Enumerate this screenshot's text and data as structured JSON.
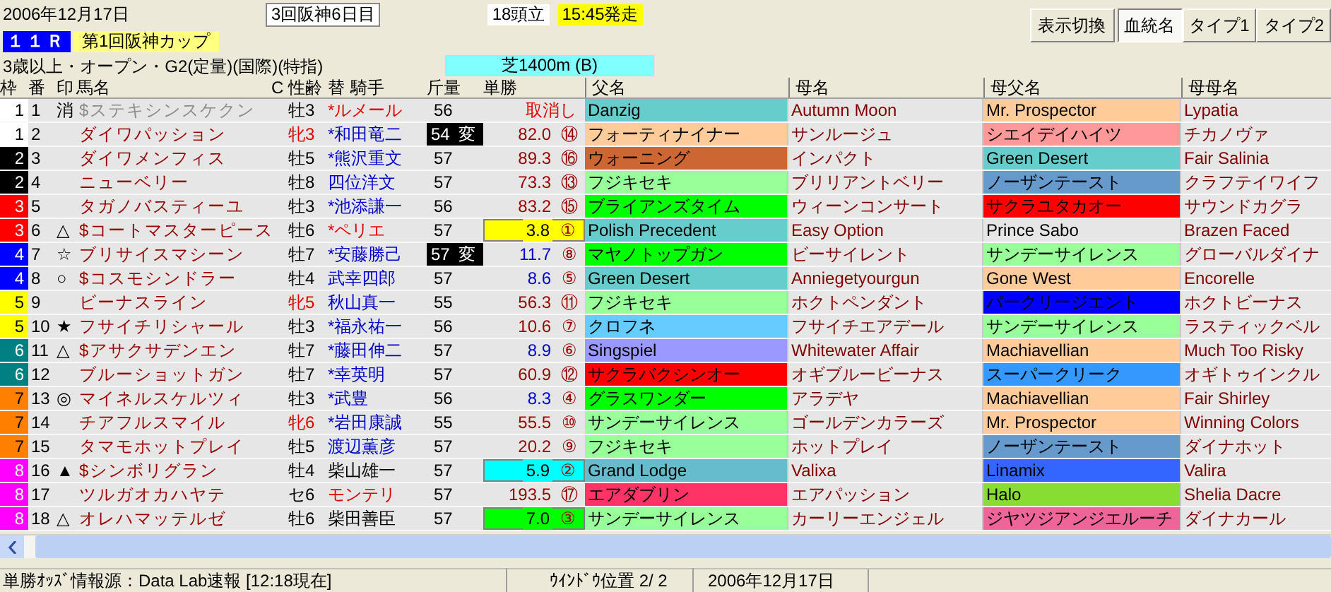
{
  "header": {
    "date": "2006年12月17日",
    "meeting": "3回阪神6日目",
    "runners": "18頭立",
    "post_time": "15:45発走",
    "race_number": "１１Ｒ",
    "race_name": "第1回阪神カップ",
    "conditions": "3歳以上・オープン・G2(定量)(国際)(特指)",
    "course": "芝1400m (B)"
  },
  "display_toggle": "表示切換",
  "view_buttons": [
    {
      "label": "血統名",
      "selected": true
    },
    {
      "label": "タイプ1",
      "selected": false
    },
    {
      "label": "タイプ2",
      "selected": false
    }
  ],
  "columns": [
    "枠",
    "番",
    "印",
    "馬名",
    "C",
    "性齢",
    "替",
    "騎手",
    "斤量",
    "単勝",
    "父名",
    "母名",
    "母父名",
    "母母名"
  ],
  "rows": [
    {
      "frame": {
        "text": "1",
        "color": "#ffffff"
      },
      "number": "1",
      "mark": "消",
      "name": "$ステキシンスケクン",
      "scratched": true,
      "sex_age": {
        "text": "牡3",
        "color": "#000000"
      },
      "jockey": {
        "text": "*ルメール",
        "color": "#e00000"
      },
      "weight": "56",
      "odds": {
        "text": "取消し",
        "color": "#e00000"
      },
      "sire": {
        "text": "Danzig",
        "color": "#66cccc"
      },
      "dam": {
        "text": "Autumn Moon"
      },
      "damsire": {
        "text": "Mr. Prospector",
        "color": "#ffcc99"
      },
      "second_dam": {
        "text": "Lypatia"
      }
    },
    {
      "frame": {
        "text": "1",
        "color": "#ffffff"
      },
      "number": "2",
      "name": "ダイワパッション",
      "scratched": false,
      "sex_age": {
        "text": "牝3",
        "color": "#e00000"
      },
      "jockey": {
        "text": "*和田竜二",
        "color": "#0000cc"
      },
      "weight": "54",
      "weight_note": "変",
      "odds": {
        "text": "82.0",
        "color": "#990000"
      },
      "rank": "⑭",
      "sire": {
        "text": "フォーティナイナー",
        "color": "#ffcc99"
      },
      "dam": {
        "text": "サンルージュ"
      },
      "damsire": {
        "text": "シエイデイハイツ",
        "color": "#ff9999"
      },
      "second_dam": {
        "text": "チカノヴァ"
      }
    },
    {
      "frame": {
        "text": "2",
        "color": "#000000"
      },
      "number": "3",
      "name": "ダイワメンフィス",
      "scratched": false,
      "sex_age": {
        "text": "牡5",
        "color": "#000000"
      },
      "jockey": {
        "text": "*熊沢重文",
        "color": "#0000cc"
      },
      "weight": "57",
      "odds": {
        "text": "89.3",
        "color": "#990000"
      },
      "rank": "⑯",
      "sire": {
        "text": "ウォーニング",
        "color": "#cc6633"
      },
      "dam": {
        "text": "インパクト"
      },
      "damsire": {
        "text": "Green Desert",
        "color": "#66cccc"
      },
      "second_dam": {
        "text": "Fair Salinia"
      }
    },
    {
      "frame": {
        "text": "2",
        "color": "#000000"
      },
      "number": "4",
      "name": "ニューベリー",
      "scratched": false,
      "sex_age": {
        "text": "牡8",
        "color": "#000000"
      },
      "jockey": {
        "text": "四位洋文",
        "color": "#0000cc"
      },
      "weight": "57",
      "odds": {
        "text": "73.3",
        "color": "#990000"
      },
      "rank": "⑬",
      "sire": {
        "text": "フジキセキ",
        "color": "#99ff99"
      },
      "dam": {
        "text": "ブリリアントベリー"
      },
      "damsire": {
        "text": "ノーザンテースト",
        "color": "#6699cc"
      },
      "second_dam": {
        "text": "クラフテイワイフ"
      }
    },
    {
      "frame": {
        "text": "3",
        "color": "#ff0000"
      },
      "number": "5",
      "name": "タガノバスティーユ",
      "scratched": false,
      "sex_age": {
        "text": "牡3",
        "color": "#000000"
      },
      "jockey": {
        "text": "*池添謙一",
        "color": "#0000cc"
      },
      "weight": "56",
      "odds": {
        "text": "83.2",
        "color": "#990000"
      },
      "rank": "⑮",
      "sire": {
        "text": "ブライアンズタイム",
        "color": "#00ff00"
      },
      "dam": {
        "text": "ウィーンコンサート"
      },
      "damsire": {
        "text": "サクラユタカオー",
        "color": "#ff0000"
      },
      "second_dam": {
        "text": "サウンドカグラ"
      }
    },
    {
      "frame": {
        "text": "3",
        "color": "#ff0000"
      },
      "number": "6",
      "mark": "△",
      "name": "$コートマスターピース",
      "scratched": false,
      "sex_age": {
        "text": "牡6",
        "color": "#000000"
      },
      "jockey": {
        "text": "*ペリエ",
        "color": "#e00000"
      },
      "weight": "57",
      "odds": {
        "text": "3.8"
      },
      "odds_box": {
        "color": "#ffff00"
      },
      "rank": "①",
      "sire": {
        "text": "Polish Precedent",
        "color": "#66cccc"
      },
      "dam": {
        "text": "Easy Option"
      },
      "damsire": {
        "text": "Prince Sabo"
      },
      "second_dam": {
        "text": "Brazen Faced"
      }
    },
    {
      "frame": {
        "text": "4",
        "color": "#0000ff"
      },
      "number": "7",
      "mark": "☆",
      "name": "ブリサイスマシーン",
      "scratched": false,
      "sex_age": {
        "text": "牡7",
        "color": "#000000"
      },
      "jockey": {
        "text": "*安藤勝己",
        "color": "#0000cc"
      },
      "weight": "57",
      "weight_note": "変",
      "odds": {
        "text": "11.7",
        "color": "#0000cc"
      },
      "rank": "⑧",
      "sire": {
        "text": "マヤノトップガン",
        "color": "#00ff00"
      },
      "dam": {
        "text": "ビーサイレント"
      },
      "damsire": {
        "text": "サンデーサイレンス",
        "color": "#99ff99"
      },
      "second_dam": {
        "text": "グローバルダイナ"
      }
    },
    {
      "frame": {
        "text": "4",
        "color": "#0000ff"
      },
      "number": "8",
      "mark": "○",
      "name": "$コスモシンドラー",
      "scratched": false,
      "sex_age": {
        "text": "牡4",
        "color": "#000000"
      },
      "jockey": {
        "text": "武幸四郎",
        "color": "#0000cc"
      },
      "weight": "57",
      "odds": {
        "text": "8.6",
        "color": "#0000cc"
      },
      "rank": "⑤",
      "sire": {
        "text": "Green Desert",
        "color": "#66cccc"
      },
      "dam": {
        "text": "Anniegetyourgun"
      },
      "damsire": {
        "text": "Gone West",
        "color": "#ffcc99"
      },
      "second_dam": {
        "text": "Encorelle"
      }
    },
    {
      "frame": {
        "text": "5",
        "color": "#ffff00"
      },
      "number": "9",
      "name": "ビーナスライン",
      "scratched": false,
      "sex_age": {
        "text": "牝5",
        "color": "#e00000"
      },
      "jockey": {
        "text": "秋山真一",
        "color": "#0000cc"
      },
      "weight": "55",
      "odds": {
        "text": "56.3",
        "color": "#990000"
      },
      "rank": "⑪",
      "sire": {
        "text": "フジキセキ",
        "color": "#99ff99"
      },
      "dam": {
        "text": "ホクトペンダント"
      },
      "damsire": {
        "text": "パークリージエント",
        "color": "#0000ff"
      },
      "second_dam": {
        "text": "ホクトビーナス"
      }
    },
    {
      "frame": {
        "text": "5",
        "color": "#ffff00"
      },
      "number": "10",
      "mark": "★",
      "name": "フサイチリシャール",
      "scratched": false,
      "sex_age": {
        "text": "牡3",
        "color": "#000000"
      },
      "jockey": {
        "text": "*福永祐一",
        "color": "#0000cc"
      },
      "weight": "56",
      "odds": {
        "text": "10.6",
        "color": "#990000"
      },
      "rank": "⑦",
      "sire": {
        "text": "クロフネ",
        "color": "#66ccff"
      },
      "dam": {
        "text": "フサイチエアデール"
      },
      "damsire": {
        "text": "サンデーサイレンス",
        "color": "#99ff99"
      },
      "second_dam": {
        "text": "ラスティックベル"
      }
    },
    {
      "frame": {
        "text": "6",
        "color": "#008080"
      },
      "number": "11",
      "mark": "△",
      "name": "$アサクサデンエン",
      "scratched": false,
      "sex_age": {
        "text": "牡7",
        "color": "#000000"
      },
      "jockey": {
        "text": "*藤田伸二",
        "color": "#0000cc"
      },
      "weight": "57",
      "odds": {
        "text": "8.9",
        "color": "#0000cc"
      },
      "rank": "⑥",
      "sire": {
        "text": "Singspiel",
        "color": "#9999ff"
      },
      "dam": {
        "text": "Whitewater Affair"
      },
      "damsire": {
        "text": "Machiavellian",
        "color": "#ffcc99"
      },
      "second_dam": {
        "text": "Much Too Risky"
      }
    },
    {
      "frame": {
        "text": "6",
        "color": "#008080"
      },
      "number": "12",
      "name": "ブルーショットガン",
      "scratched": false,
      "sex_age": {
        "text": "牡7",
        "color": "#000000"
      },
      "jockey": {
        "text": "*幸英明",
        "color": "#0000cc"
      },
      "weight": "57",
      "odds": {
        "text": "60.9",
        "color": "#990000"
      },
      "rank": "⑫",
      "sire": {
        "text": "サクラバクシンオー",
        "color": "#ff0000"
      },
      "dam": {
        "text": "オギブルービーナス"
      },
      "damsire": {
        "text": "スーパークリーク",
        "color": "#3399ff"
      },
      "second_dam": {
        "text": "オギトゥインクル"
      }
    },
    {
      "frame": {
        "text": "7",
        "color": "#ff8000"
      },
      "number": "13",
      "mark": "◎",
      "name": "マイネルスケルツィ",
      "scratched": false,
      "sex_age": {
        "text": "牡3",
        "color": "#000000"
      },
      "jockey": {
        "text": "*武豊",
        "color": "#0000cc"
      },
      "weight": "56",
      "odds": {
        "text": "8.3",
        "color": "#0000cc"
      },
      "rank": "④",
      "sire": {
        "text": "グラスワンダー",
        "color": "#00ff00"
      },
      "dam": {
        "text": "アラデヤ"
      },
      "damsire": {
        "text": "Machiavellian",
        "color": "#ffcc99"
      },
      "second_dam": {
        "text": "Fair Shirley"
      }
    },
    {
      "frame": {
        "text": "7",
        "color": "#ff8000"
      },
      "number": "14",
      "name": "チアフルスマイル",
      "scratched": false,
      "sex_age": {
        "text": "牝6",
        "color": "#e00000"
      },
      "jockey": {
        "text": "*岩田康誠",
        "color": "#0000cc"
      },
      "weight": "55",
      "odds": {
        "text": "55.5",
        "color": "#990000"
      },
      "rank": "⑩",
      "sire": {
        "text": "サンデーサイレンス",
        "color": "#99ff99"
      },
      "dam": {
        "text": "ゴールデンカラーズ"
      },
      "damsire": {
        "text": "Mr. Prospector",
        "color": "#ffcc99"
      },
      "second_dam": {
        "text": "Winning Colors"
      }
    },
    {
      "frame": {
        "text": "7",
        "color": "#ff8000"
      },
      "number": "15",
      "name": "タマモホットプレイ",
      "scratched": false,
      "sex_age": {
        "text": "牡5",
        "color": "#000000"
      },
      "jockey": {
        "text": "渡辺薫彦",
        "color": "#0000cc"
      },
      "weight": "57",
      "odds": {
        "text": "20.2",
        "color": "#990000"
      },
      "rank": "⑨",
      "sire": {
        "text": "フジキセキ",
        "color": "#99ff99"
      },
      "dam": {
        "text": "ホットプレイ"
      },
      "damsire": {
        "text": "ノーザンテースト",
        "color": "#6699cc"
      },
      "second_dam": {
        "text": "ダイナホット"
      }
    },
    {
      "frame": {
        "text": "8",
        "color": "#ff00ff"
      },
      "number": "16",
      "mark": "▲",
      "name": "$シンボリグラン",
      "scratched": false,
      "sex_age": {
        "text": "牡4",
        "color": "#000000"
      },
      "jockey": {
        "text": "柴山雄一",
        "color": "#000000"
      },
      "weight": "57",
      "odds": {
        "text": "5.9"
      },
      "odds_box": {
        "color": "#00ffff"
      },
      "rank": "②",
      "sire": {
        "text": "Grand Lodge",
        "color": "#66bbcc"
      },
      "dam": {
        "text": "Valixa"
      },
      "damsire": {
        "text": "Linamix",
        "color": "#3366ff"
      },
      "second_dam": {
        "text": "Valira"
      }
    },
    {
      "frame": {
        "text": "8",
        "color": "#ff00ff"
      },
      "number": "17",
      "name": "ツルガオカハヤテ",
      "scratched": false,
      "sex_age": {
        "text": "セ6",
        "color": "#000000"
      },
      "jockey": {
        "text": "モンテリ",
        "color": "#e00000"
      },
      "weight": "57",
      "odds": {
        "text": "193.5",
        "color": "#990000"
      },
      "rank": "⑰",
      "sire": {
        "text": "エアダブリン",
        "color": "#ff3366"
      },
      "dam": {
        "text": "エアパッション"
      },
      "damsire": {
        "text": "Halo",
        "color": "#88dd33"
      },
      "second_dam": {
        "text": "Shelia Dacre"
      }
    },
    {
      "frame": {
        "text": "8",
        "color": "#ff00ff"
      },
      "number": "18",
      "mark": "△",
      "name": "オレハマッテルゼ",
      "scratched": false,
      "sex_age": {
        "text": "牡6",
        "color": "#000000"
      },
      "jockey": {
        "text": "柴田善臣",
        "color": "#000000"
      },
      "weight": "57",
      "odds": {
        "text": "7.0"
      },
      "odds_box": {
        "color": "#00ff00"
      },
      "rank": "③",
      "sire": {
        "text": "サンデーサイレンス",
        "color": "#99ff99"
      },
      "dam": {
        "text": "カーリーエンジェル"
      },
      "damsire": {
        "text": "ジヤツジアンジエルーチ",
        "color": "#ee6699"
      },
      "second_dam": {
        "text": "ダイナカール"
      }
    }
  ],
  "status_bar": {
    "source": "単勝ｵｯｽﾞ情報源：Data Lab速報 [12:18現在]",
    "window_position": "ｳｲﾝﾄﾞｳ位置 2/ 2",
    "date": "2006年12月17日"
  }
}
